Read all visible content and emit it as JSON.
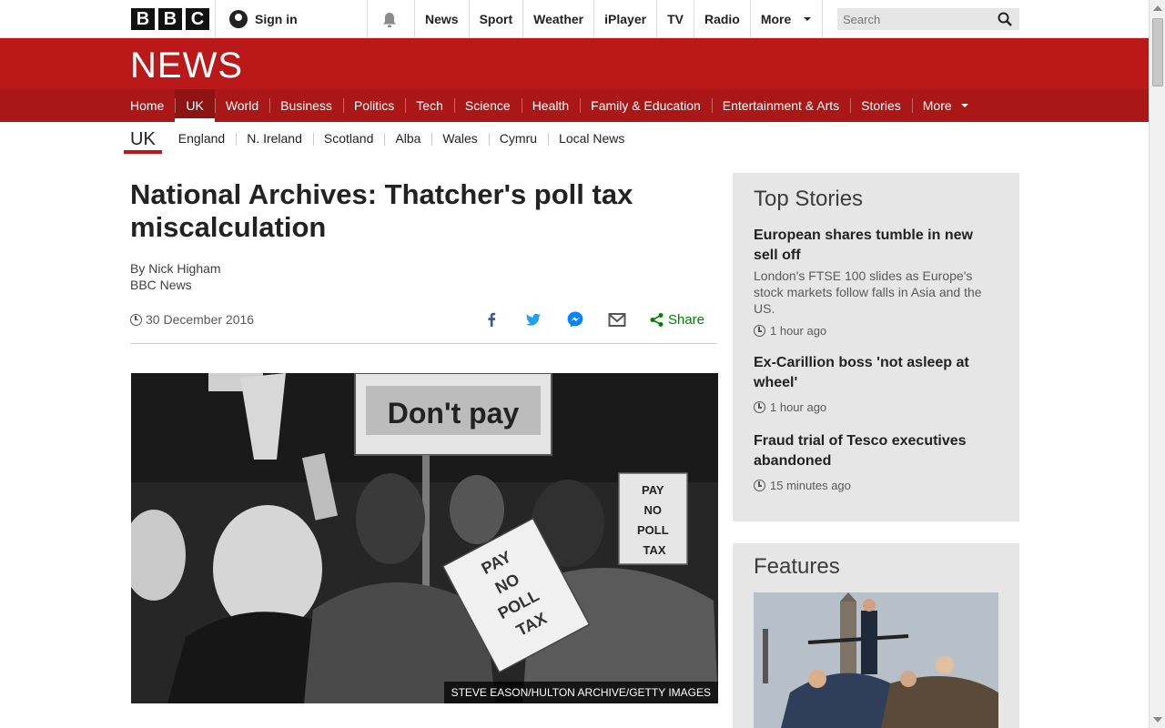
{
  "topbar": {
    "bbc_letters": [
      "B",
      "B",
      "C"
    ],
    "sign_in": "Sign in",
    "nav": [
      "News",
      "Sport",
      "Weather",
      "iPlayer",
      "TV",
      "Radio",
      "More"
    ],
    "search_placeholder": "Search"
  },
  "banner": {
    "logo": "NEWS"
  },
  "section_nav": {
    "items": [
      "Home",
      "UK",
      "World",
      "Business",
      "Politics",
      "Tech",
      "Science",
      "Health",
      "Family & Education",
      "Entertainment & Arts",
      "Stories"
    ],
    "active": "UK",
    "more": "More"
  },
  "sub_nav": {
    "title": "UK",
    "items": [
      "England",
      "N. Ireland",
      "Scotland",
      "Alba",
      "Wales",
      "Cymru",
      "Local News"
    ]
  },
  "article": {
    "headline": "National Archives: Thatcher's poll tax miscalculation",
    "author": "By Nick Higham",
    "source": "BBC News",
    "date": "30 December 2016",
    "share_label": "Share",
    "image_credit": "STEVE EASON/HULTON ARCHIVE/GETTY IMAGES",
    "image_signs": [
      "Don't pay",
      "PAY NO POLL TAX",
      "PAY NO POLL TAX"
    ]
  },
  "top_stories": {
    "heading": "Top Stories",
    "items": [
      {
        "title": "European shares tumble in new sell off",
        "summary": "London's FTSE 100 slides as Europe's stock markets follow falls in Asia and the US.",
        "time": "1 hour ago"
      },
      {
        "title": "Ex-Carillion boss 'not asleep at wheel'",
        "time": "1 hour ago"
      },
      {
        "title": "Fraud trial of Tesco executives abandoned",
        "time": "15 minutes ago"
      }
    ]
  },
  "features": {
    "heading": "Features"
  },
  "colors": {
    "brand_red": "#bb1919",
    "nav_red": "#a91717",
    "share_green": "#008000"
  }
}
